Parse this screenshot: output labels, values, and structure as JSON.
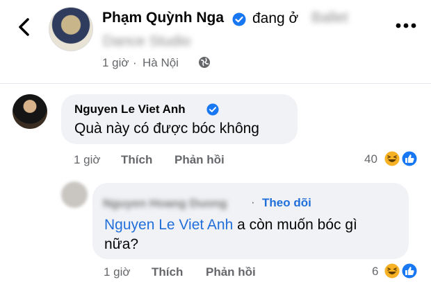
{
  "post": {
    "author": "Phạm Quỳnh Nga",
    "status_word": "đang ở",
    "blurred_location_1": "Ballet",
    "blurred_location_2": "Dance Studio",
    "time": "1 giờ",
    "separator": "·",
    "place": "Hà Nội",
    "privacy_icon": "globe-icon"
  },
  "colors": {
    "link": "#216fdb",
    "verified": "#1877f2",
    "bubble": "#f0f2f5",
    "meta": "#65676b"
  },
  "comment": {
    "author": "Nguyen Le Viet Anh",
    "text": "Quà này có được bóc không",
    "time": "1 giờ",
    "like_label": "Thích",
    "reply_label": "Phản hồi",
    "reaction_count": "40",
    "reactions": [
      "haha-icon",
      "like-icon"
    ]
  },
  "reply": {
    "author_blurred": "Nguyen Hoang Duong",
    "separator": "·",
    "follow_label": "Theo dõi",
    "mention": "Nguyen Le Viet Anh",
    "text_after_mention": " a còn muốn bóc gì",
    "text_line2": "nữa?",
    "time": "1 giờ",
    "like_label": "Thích",
    "reply_label": "Phản hồi",
    "reaction_count": "6",
    "reactions": [
      "haha-icon",
      "like-icon"
    ]
  }
}
